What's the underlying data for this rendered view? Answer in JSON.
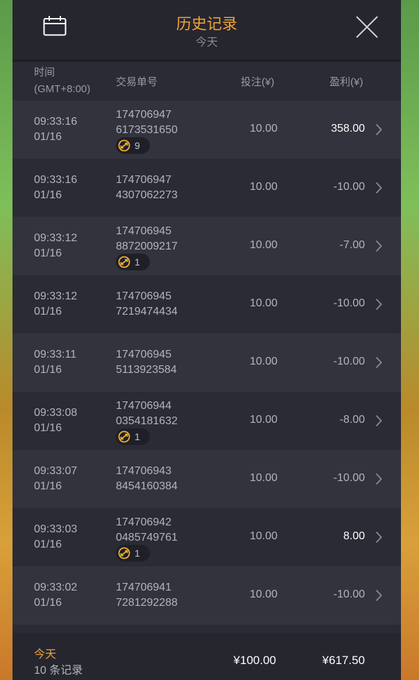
{
  "header": {
    "title": "历史记录",
    "subtitle": "今天",
    "calendar_icon": "calendar-icon",
    "close_icon": "close-icon"
  },
  "columns": {
    "time_line1": "时间",
    "time_line2": "(GMT+8:00)",
    "order_id": "交易单号",
    "bet": "投注(¥)",
    "profit": "盈利(¥)"
  },
  "rows": [
    {
      "time": "09:33:16",
      "date": "01/16",
      "id1": "174706947",
      "id2": "6173531650",
      "badge": "9",
      "bet": "10.00",
      "profit": "358.00",
      "positive": true
    },
    {
      "time": "09:33:16",
      "date": "01/16",
      "id1": "174706947",
      "id2": "4307062273",
      "badge": "",
      "bet": "10.00",
      "profit": "-10.00",
      "positive": false
    },
    {
      "time": "09:33:12",
      "date": "01/16",
      "id1": "174706945",
      "id2": "8872009217",
      "badge": "1",
      "bet": "10.00",
      "profit": "-7.00",
      "positive": false
    },
    {
      "time": "09:33:12",
      "date": "01/16",
      "id1": "174706945",
      "id2": "7219474434",
      "badge": "",
      "bet": "10.00",
      "profit": "-10.00",
      "positive": false
    },
    {
      "time": "09:33:11",
      "date": "01/16",
      "id1": "174706945",
      "id2": "5113923584",
      "badge": "",
      "bet": "10.00",
      "profit": "-10.00",
      "positive": false
    },
    {
      "time": "09:33:08",
      "date": "01/16",
      "id1": "174706944",
      "id2": "0354181632",
      "badge": "1",
      "bet": "10.00",
      "profit": "-8.00",
      "positive": false
    },
    {
      "time": "09:33:07",
      "date": "01/16",
      "id1": "174706943",
      "id2": "8454160384",
      "badge": "",
      "bet": "10.00",
      "profit": "-10.00",
      "positive": false
    },
    {
      "time": "09:33:03",
      "date": "01/16",
      "id1": "174706942",
      "id2": "0485749761",
      "badge": "1",
      "bet": "10.00",
      "profit": "8.00",
      "positive": true
    },
    {
      "time": "09:33:02",
      "date": "01/16",
      "id1": "174706941",
      "id2": "7281292288",
      "badge": "",
      "bet": "10.00",
      "profit": "-10.00",
      "positive": false
    }
  ],
  "footer": {
    "label": "今天",
    "count": "10 条记录",
    "total_bet": "¥100.00",
    "total_profit": "¥617.50"
  },
  "colors": {
    "accent": "#f0a23a",
    "panel": "#2b2b35",
    "row_alt": "#33333d"
  }
}
